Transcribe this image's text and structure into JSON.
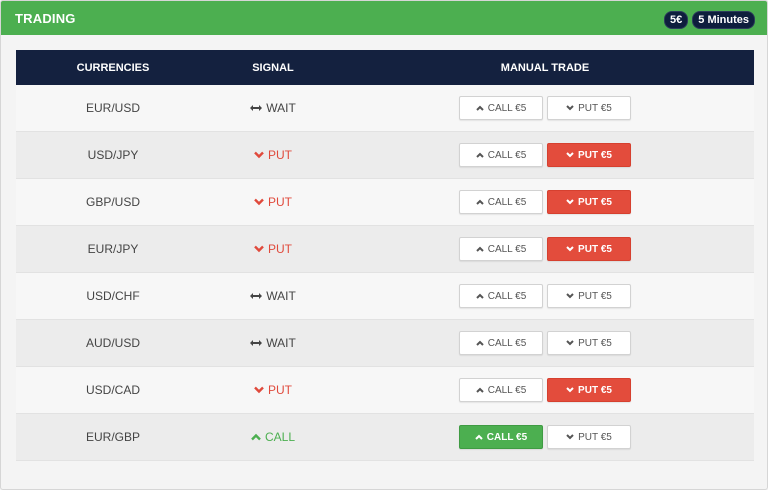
{
  "header": {
    "title": "TRADING",
    "amount_badge": "5€",
    "duration_badge": "5 Minutes"
  },
  "table": {
    "columns": [
      "CURRENCIES",
      "SIGNAL",
      "MANUAL TRADE"
    ],
    "rows": [
      {
        "currency": "EUR/USD",
        "signal": "WAIT",
        "signal_type": "wait",
        "call_label": "CALL €5",
        "put_label": "PUT €5",
        "active": "none"
      },
      {
        "currency": "USD/JPY",
        "signal": "PUT",
        "signal_type": "put",
        "call_label": "CALL €5",
        "put_label": "PUT €5",
        "active": "put"
      },
      {
        "currency": "GBP/USD",
        "signal": "PUT",
        "signal_type": "put",
        "call_label": "CALL €5",
        "put_label": "PUT €5",
        "active": "put"
      },
      {
        "currency": "EUR/JPY",
        "signal": "PUT",
        "signal_type": "put",
        "call_label": "CALL €5",
        "put_label": "PUT €5",
        "active": "put"
      },
      {
        "currency": "USD/CHF",
        "signal": "WAIT",
        "signal_type": "wait",
        "call_label": "CALL €5",
        "put_label": "PUT €5",
        "active": "none"
      },
      {
        "currency": "AUD/USD",
        "signal": "WAIT",
        "signal_type": "wait",
        "call_label": "CALL €5",
        "put_label": "PUT €5",
        "active": "none"
      },
      {
        "currency": "USD/CAD",
        "signal": "PUT",
        "signal_type": "put",
        "call_label": "CALL €5",
        "put_label": "PUT €5",
        "active": "put"
      },
      {
        "currency": "EUR/GBP",
        "signal": "CALL",
        "signal_type": "call",
        "call_label": "CALL €5",
        "put_label": "PUT €5",
        "active": "call"
      }
    ]
  },
  "colors": {
    "header_green": "#4caf50",
    "table_head_navy": "#14213f",
    "put_red": "#e34c3c",
    "call_green": "#4caf50"
  },
  "icons": {
    "wait": "double-arrow-icon",
    "put": "chevron-down-icon",
    "call": "chevron-up-icon"
  }
}
